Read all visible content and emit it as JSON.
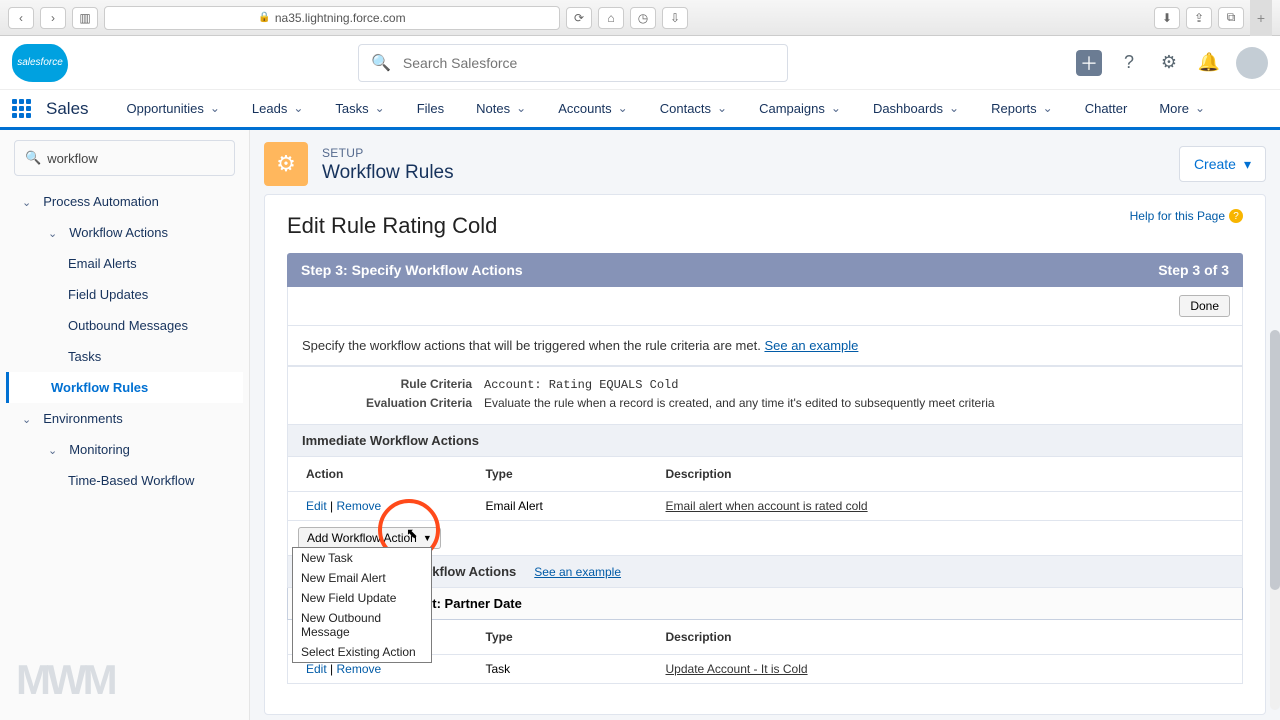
{
  "browser": {
    "url": "na35.lightning.force.com"
  },
  "header": {
    "search_placeholder": "Search Salesforce"
  },
  "nav": {
    "app": "Sales",
    "items": [
      "Opportunities",
      "Leads",
      "Tasks",
      "Files",
      "Notes",
      "Accounts",
      "Contacts",
      "Campaigns",
      "Dashboards",
      "Reports",
      "Chatter",
      "More"
    ]
  },
  "sidebar": {
    "search_value": "workflow",
    "tree": {
      "process_automation": "Process Automation",
      "workflow_actions": "Workflow Actions",
      "email_alerts": "Email Alerts",
      "field_updates": "Field Updates",
      "outbound_messages": "Outbound Messages",
      "tasks": "Tasks",
      "workflow_rules": "Workflow Rules",
      "environments": "Environments",
      "monitoring": "Monitoring",
      "time_based": "Time-Based Workflow"
    }
  },
  "setup": {
    "label": "SETUP",
    "title": "Workflow Rules",
    "create": "Create"
  },
  "page": {
    "title": "Edit Rule Rating Cold",
    "help": "Help for this Page",
    "step_title": "Step 3: Specify Workflow Actions",
    "step_count": "Step 3 of 3",
    "done": "Done",
    "instruction": "Specify the workflow actions that will be triggered when the rule criteria are met.",
    "see_example": "See an example",
    "rule_criteria_label": "Rule Criteria",
    "rule_criteria_value": "Account: Rating EQUALS Cold",
    "eval_label": "Evaluation Criteria",
    "eval_value": "Evaluate the rule when a record is created, and any time it's edited to subsequently meet criteria",
    "immediate_header": "Immediate Workflow Actions",
    "col_action": "Action",
    "col_type": "Type",
    "col_desc": "Description",
    "row1_edit": "Edit",
    "row1_remove": "Remove",
    "row1_type": "Email Alert",
    "row1_desc": "Email alert when account is rated cold",
    "add_action": "Add Workflow Action",
    "menu": {
      "new_task": "New Task",
      "new_email": "New Email Alert",
      "new_field": "New Field Update",
      "new_outbound": "New Outbound Message",
      "select_existing": "Select Existing Action"
    },
    "timed_header": "Time-Dependent Workflow Actions",
    "trigger_label": "1 Day Before Account: Partner Date",
    "row2_edit": "Edit",
    "row2_remove": "Remove",
    "row2_type": "Task",
    "row2_desc": "Update Account - It is Cold"
  },
  "watermark": "MWM"
}
